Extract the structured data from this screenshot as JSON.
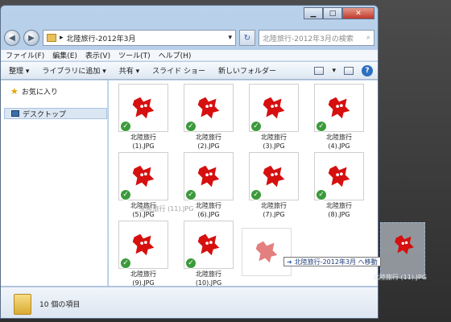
{
  "window": {
    "minimize_glyph": "▁",
    "maximize_glyph": "□",
    "close_glyph": "✕"
  },
  "nav": {
    "back_glyph": "◀",
    "forward_glyph": "▶",
    "address_separator": "▸",
    "breadcrumb": "北陸旅行-2012年3月",
    "address_dropdown": "▾",
    "refresh_glyph": "↻",
    "search_placeholder": "北陸旅行-2012年3月の検索",
    "search_icon_glyph": "⌕"
  },
  "menu": [
    "ファイル(F)",
    "編集(E)",
    "表示(V)",
    "ツール(T)",
    "ヘルプ(H)"
  ],
  "commands": [
    "整理 ▾",
    "ライブラリに追加 ▾",
    "共有 ▾",
    "スライド ショー",
    "新しいフォルダー"
  ],
  "command_right": {
    "view_glyph": "▾",
    "help_glyph": "?"
  },
  "navpane": {
    "favorites": "お気に入り",
    "desktop": "デスクトップ"
  },
  "files": [
    "北陸旅行 (1).JPG",
    "北陸旅行 (2).JPG",
    "北陸旅行 (3).JPG",
    "北陸旅行 (4).JPG",
    "北陸旅行 (5).JPG",
    "北陸旅行 (6).JPG",
    "北陸旅行 (7).JPG",
    "北陸旅行 (8).JPG",
    "北陸旅行 (9).JPG",
    "北陸旅行 (10).JPG"
  ],
  "files_line1": "北陸旅行",
  "files_line2": [
    "(1).JPG",
    "(2).JPG",
    "(3).JPG",
    "(4).JPG",
    "(5).JPG",
    "(6).JPG",
    "(7).JPG",
    "(8).JPG",
    "(9).JPG",
    "(10).JPG"
  ],
  "ghost_file": "北陸旅行 (11).JPG",
  "drag": {
    "tooltip": "北陸旅行-2012年3月 へ移動",
    "tooltip_arrow": "➜",
    "file_label": "北陸旅行 (11).JPG"
  },
  "status": {
    "count": "10 個の項目"
  },
  "colors": {
    "thumb_red": "#d60f0f",
    "check_green": "#3c9a3c"
  }
}
